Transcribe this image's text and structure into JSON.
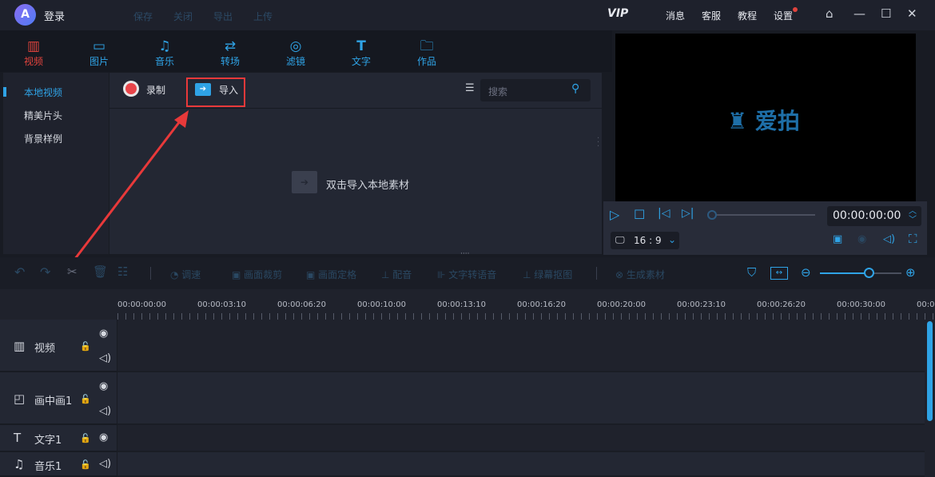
{
  "topbar": {
    "login": "登录",
    "menu": [
      "保存",
      "关闭",
      "导出",
      "上传"
    ],
    "right": [
      "VIP",
      "消息",
      "客服",
      "教程",
      "设置"
    ]
  },
  "tabs": [
    {
      "label": "视频",
      "icon": "film-icon"
    },
    {
      "label": "图片",
      "icon": "image-icon"
    },
    {
      "label": "音乐",
      "icon": "music-icon"
    },
    {
      "label": "转场",
      "icon": "transition-icon"
    },
    {
      "label": "滤镜",
      "icon": "filter-icon"
    },
    {
      "label": "文字",
      "icon": "text-icon"
    },
    {
      "label": "作品",
      "icon": "folder-icon"
    }
  ],
  "leftnav": [
    "本地视频",
    "精美片头",
    "背景样例"
  ],
  "main": {
    "record": "录制",
    "import": "导入",
    "search_placeholder": "搜索",
    "empty_hint": "双击导入本地素材"
  },
  "preview": {
    "logo_text": "爱拍",
    "time": "00:00:00:00",
    "ratio": "16 : 9"
  },
  "toolbar": [
    "调速",
    "画面裁剪",
    "画面定格",
    "配音",
    "文字转语音",
    "绿幕抠图",
    "生成素材"
  ],
  "zoom_level": 0.6,
  "ruler": [
    "00:00:00:00",
    "00:00:03:10",
    "00:00:06:20",
    "00:00:10:00",
    "00:00:13:10",
    "00:00:16:20",
    "00:00:20:00",
    "00:00:23:10",
    "00:00:26:20",
    "00:00:30:00",
    "00:0"
  ],
  "tracks": [
    "视频",
    "画中画1",
    "文字1",
    "音乐1"
  ],
  "colors": {
    "accent": "#2fa3e6",
    "active": "#e0433d"
  }
}
